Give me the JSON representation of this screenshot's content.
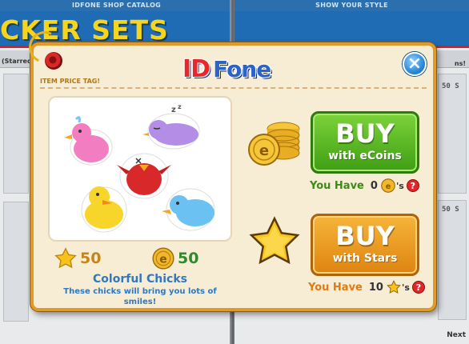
{
  "background": {
    "left_header": "IDFONE SHOP CATALOG",
    "right_header": "SHOW YOUR STYLE",
    "left_title": "CKER SETS",
    "left_tab": "(Starred",
    "right_tab": "ns!",
    "price_label_1": "50 S",
    "price_label_2": "50 S",
    "next": "Next"
  },
  "modal": {
    "tag_label": "ITEM PRICE TAG!",
    "logo_id": "ID",
    "logo_fone": "Fone",
    "close_glyph": "×"
  },
  "item": {
    "name": "Colorful Chicks",
    "description": "These chicks will bring you lots of smiles!",
    "price_stars": "50",
    "price_ecoins": "50"
  },
  "buy_ecoins": {
    "big": "BUY",
    "small": "with eCoins",
    "have_label": "You Have",
    "have_count": "0",
    "suffix": "'s",
    "help": "?"
  },
  "buy_stars": {
    "big": "BUY",
    "small": "with Stars",
    "have_label": "You Have",
    "have_count": "10",
    "suffix": "'s",
    "help": "?"
  },
  "colors": {
    "ecoin_green": "#3f9e14",
    "star_orange": "#de8410",
    "modal_border": "#e09a2a",
    "text_blue": "#2f78c4"
  }
}
